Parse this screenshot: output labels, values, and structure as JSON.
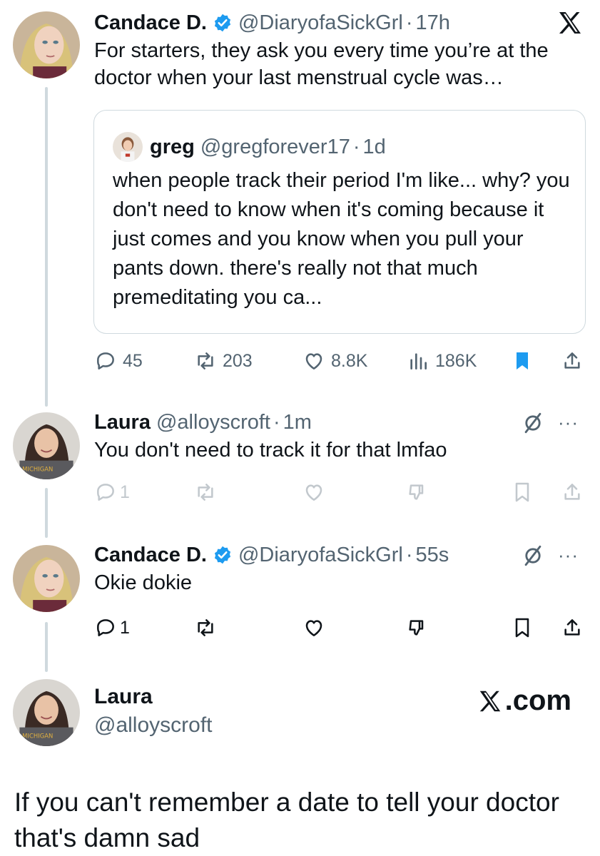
{
  "posts": {
    "p1": {
      "name": "Candace D.",
      "handle": "@DiaryofaSickGrl",
      "time": "17h",
      "text": "For starters, they ask you every time you’re at the doctor when your last menstrual cycle was…",
      "quote": {
        "name": "greg",
        "handle": "@gregforever17",
        "time": "1d",
        "text": "when people track their period I'm like... why? you don't need to know when it's coming because it just comes and you know when you pull your pants down. there's really not that much premeditating you ca..."
      },
      "stats": {
        "replies": "45",
        "reposts": "203",
        "likes": "8.8K",
        "views": "186K"
      }
    },
    "p2": {
      "name": "Laura",
      "handle": "@alloyscroft",
      "time": "1m",
      "text": "You don't need to track it for that lmfao",
      "stats": {
        "replies": "1"
      }
    },
    "p3": {
      "name": "Candace D.",
      "handle": "@DiaryofaSickGrl",
      "time": "55s",
      "text": "Okie dokie",
      "stats": {
        "replies": "1"
      }
    },
    "p4": {
      "name": "Laura",
      "handle": "@alloyscroft",
      "text": "If you can't remember a date to tell your doctor that's damn sad"
    }
  },
  "separator": "·",
  "more": "···",
  "brand": {
    "xcom": ".com"
  },
  "icons": {
    "logo": "x-logo-icon",
    "verified": "verified-badge-icon",
    "reply": "reply-icon",
    "repost": "repost-icon",
    "like": "heart-icon",
    "views": "views-chart-icon",
    "bookmark": "bookmark-icon",
    "share": "share-icon",
    "dislike": "downvote-icon",
    "grok": "grok-icon"
  },
  "colors": {
    "accent": "#1d9bf0",
    "muted": "#536471",
    "border": "#cfd9de"
  }
}
